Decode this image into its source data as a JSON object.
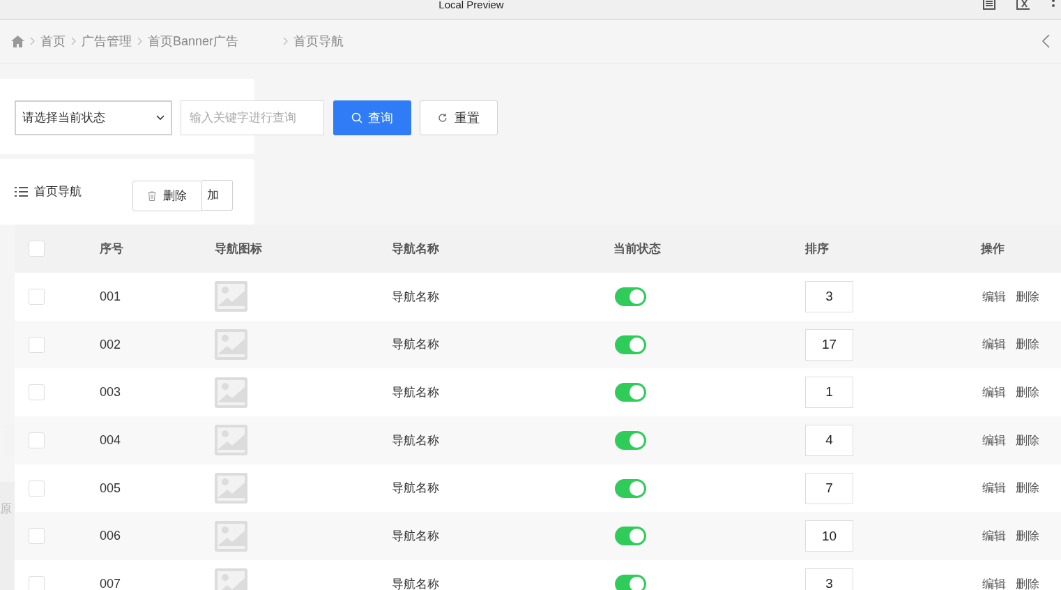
{
  "window": {
    "title": "Local Preview"
  },
  "breadcrumb": [
    {
      "label": "首页"
    },
    {
      "label": "广告管理"
    },
    {
      "label": "首页Banner广告"
    },
    {
      "label": "首页导航"
    }
  ],
  "filter": {
    "status_select": "请选择当前状态",
    "search": {
      "placeholder": "输入关键字进行查询"
    },
    "query_button": "查询",
    "reset_button": "重置"
  },
  "section": {
    "title": "首页导航",
    "delete_button": "删除",
    "add_button": "加"
  },
  "side_fragment": "原",
  "table": {
    "select_all": {
      "checked": false
    },
    "columns": [
      "序号",
      "导航图标",
      "导航名称",
      "当前状态",
      "排序",
      "操作"
    ],
    "rows": [
      {
        "checked": false,
        "index": "001",
        "name": "导航名称",
        "on": true,
        "sort": "3",
        "actions": [
          "编辑",
          "删除"
        ]
      },
      {
        "checked": false,
        "index": "002",
        "name": "导航名称",
        "on": true,
        "sort": "17",
        "actions": [
          "编辑",
          "删除"
        ]
      },
      {
        "checked": false,
        "index": "003",
        "name": "导航名称",
        "on": true,
        "sort": "1",
        "actions": [
          "编辑",
          "删除"
        ]
      },
      {
        "checked": false,
        "index": "004",
        "name": "导航名称",
        "on": true,
        "sort": "4",
        "actions": [
          "编辑",
          "删除"
        ]
      },
      {
        "checked": false,
        "index": "005",
        "name": "导航名称",
        "on": true,
        "sort": "7",
        "actions": [
          "编辑",
          "删除"
        ]
      },
      {
        "checked": false,
        "index": "006",
        "name": "导航名称",
        "on": true,
        "sort": "10",
        "actions": [
          "编辑",
          "删除"
        ]
      },
      {
        "checked": false,
        "index": "007",
        "name": "导航名称",
        "on": true,
        "sort": "3",
        "actions": [
          "编辑",
          "删除"
        ]
      }
    ]
  }
}
